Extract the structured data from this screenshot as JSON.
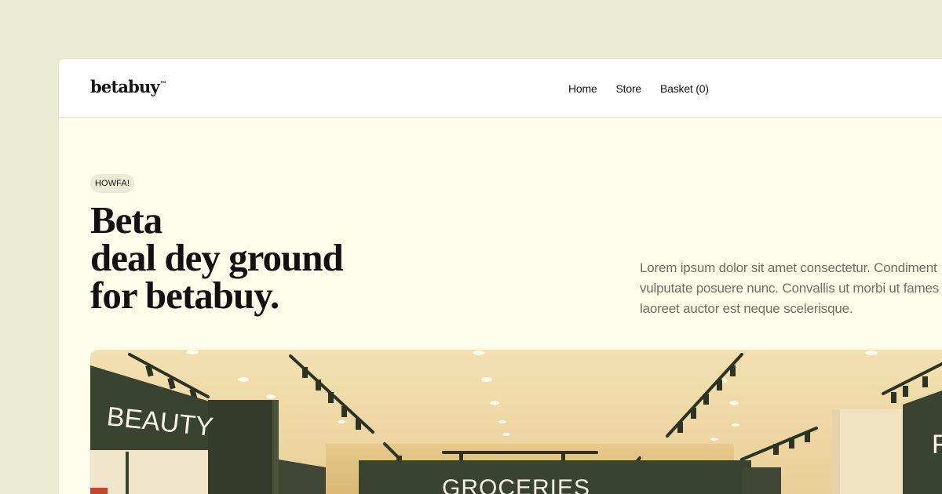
{
  "brand": {
    "name": "betabuy",
    "trademark": "™"
  },
  "nav": {
    "items": [
      {
        "label": "Home"
      },
      {
        "label": "Store"
      },
      {
        "label": "Basket (0)"
      }
    ]
  },
  "hero": {
    "badge": "HOWFA!",
    "headline_lines": [
      "Beta",
      "deal dey ground",
      "for betabuy."
    ],
    "intro_lines": [
      "Lorem ipsum dolor sit amet consectetur. Condiment",
      "vulputate posuere nunc. Convallis ut morbi ut fames",
      "laoreet auctor est neque scelerisque."
    ],
    "image": {
      "signs": [
        "BEAUTY",
        "GROCERIES",
        "F"
      ]
    }
  },
  "colors": {
    "page_bg": "#ebead2",
    "frame_bg": "#fffeea",
    "badge_bg": "#ebebd5",
    "sign_green": "#3a4230",
    "ceiling": "#f2dfb2"
  }
}
